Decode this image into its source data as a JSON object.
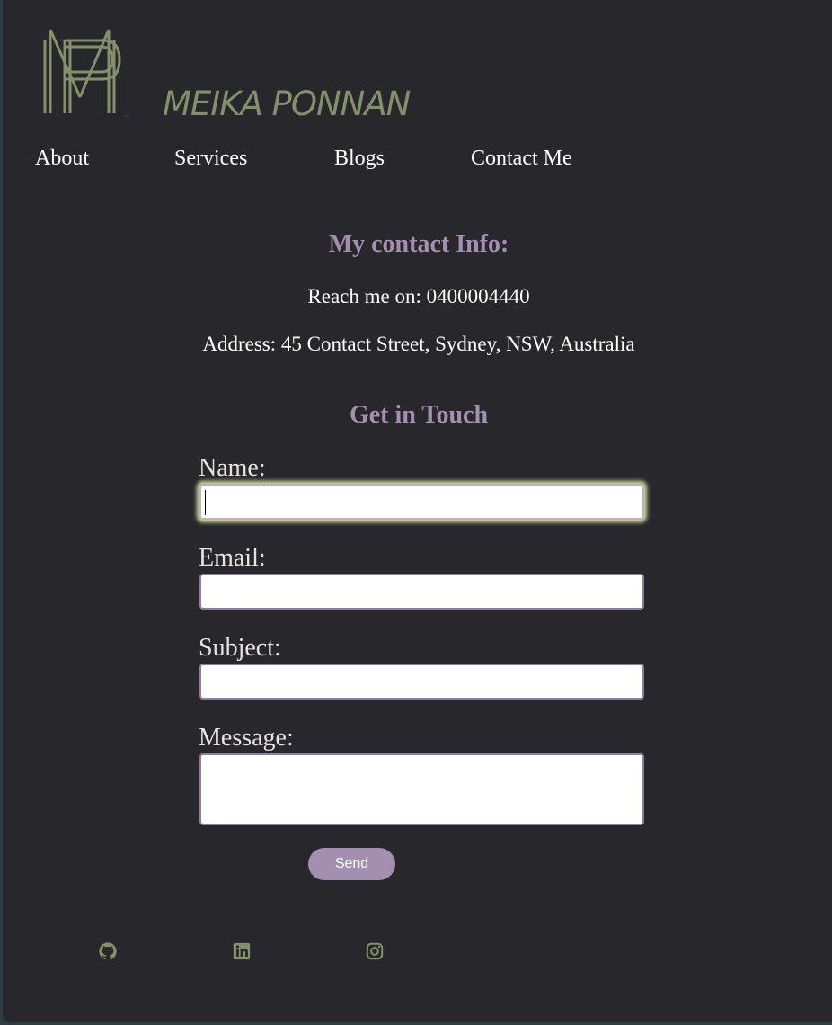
{
  "brand": {
    "name": "MEIKA PONNAN",
    "logo_icon": "mp-monogram-icon",
    "color": "#848f6b"
  },
  "nav": {
    "items": [
      "About",
      "Services",
      "Blogs",
      "Contact Me"
    ]
  },
  "contact": {
    "heading": "My contact Info:",
    "phone_line": "Reach me on: 0400004440",
    "address_line": "Address: 45 Contact Street, Sydney, NSW, Australia"
  },
  "form": {
    "heading": "Get in Touch",
    "name_label": "Name:",
    "email_label": "Email:",
    "subject_label": "Subject:",
    "message_label": "Message:",
    "send_label": "Send"
  },
  "social": {
    "icons": [
      "github-icon",
      "linkedin-icon",
      "instagram-icon"
    ]
  },
  "colors": {
    "accent": "#a58fb1",
    "background": "#27272c",
    "icon": "#848f6b",
    "focus_glow": "#d8e19a"
  }
}
